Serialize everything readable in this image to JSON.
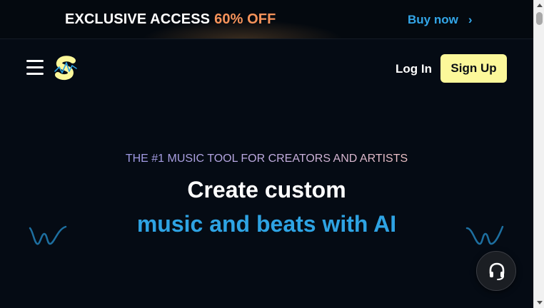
{
  "promo": {
    "label": "EXCLUSIVE ACCESS",
    "discount": "60% OFF",
    "cta": "Buy now",
    "cta_icon": "chevron-right-icon"
  },
  "nav": {
    "menu_icon": "hamburger-menu-icon",
    "logo_icon": "s-logo-icon",
    "login_label": "Log In",
    "signup_label": "Sign Up"
  },
  "hero": {
    "eyebrow": "THE #1 MUSIC TOOL FOR CREATORS AND ARTISTS",
    "headline": "Create custom",
    "subheadline": "music and beats with AI"
  },
  "support": {
    "icon": "headset-icon"
  },
  "colors": {
    "background": "#050b14",
    "accent_blue": "#2ea3e3",
    "discount_orange": "#f7935a",
    "signup_yellow": "#fcf89a"
  }
}
